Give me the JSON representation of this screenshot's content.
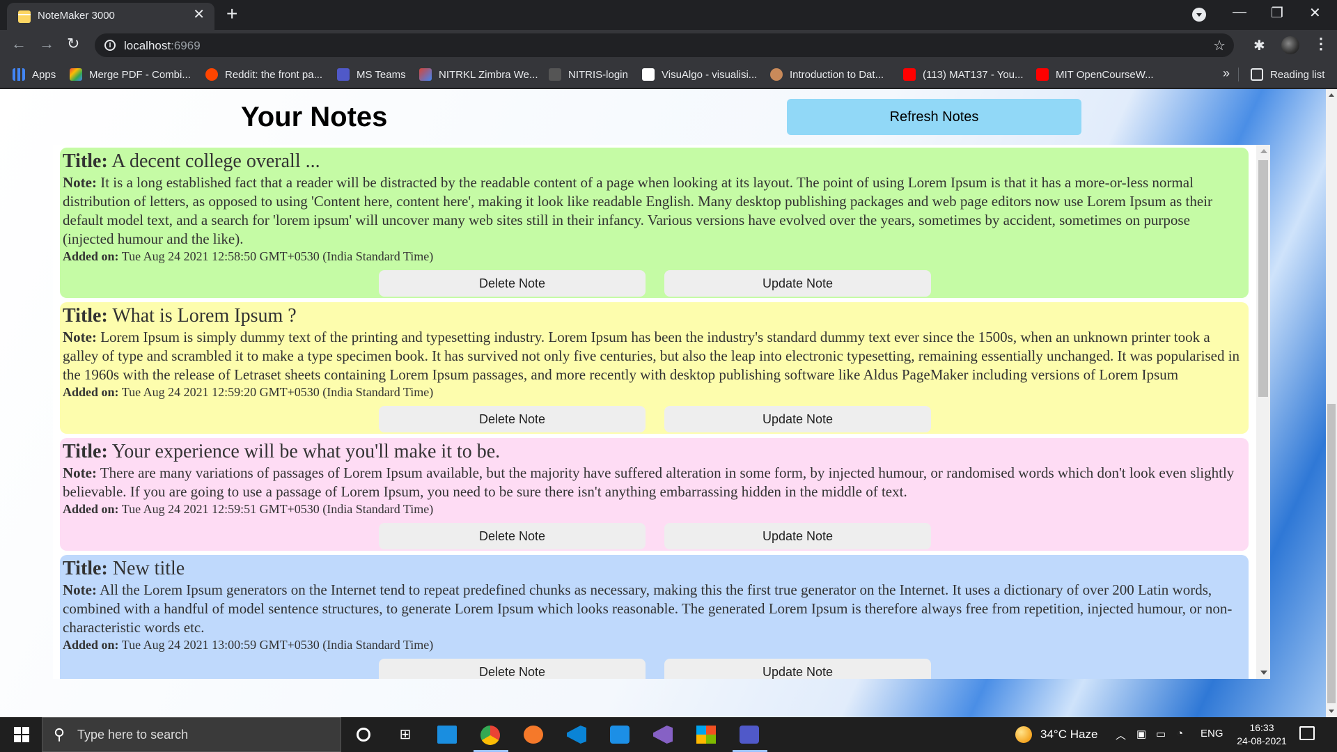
{
  "browser": {
    "tab_title": "NoteMaker 3000",
    "new_tab": "+",
    "url_host": "localhost",
    "url_port": ":6969",
    "window_controls": [
      "—",
      "❐",
      "✕"
    ]
  },
  "bookmarks": [
    {
      "label": "Apps",
      "color": "#4285f4"
    },
    {
      "label": "Merge PDF - Combi...",
      "color": "#e94335"
    },
    {
      "label": "Reddit: the front pa...",
      "color": "#ff4500"
    },
    {
      "label": "MS Teams",
      "color": "#5059c9"
    },
    {
      "label": "NITRKL Zimbra We...",
      "color": "#d44638"
    },
    {
      "label": "NITRIS-login",
      "color": "#777777"
    },
    {
      "label": "VisuAlgo - visualisi...",
      "color": "#ffffff"
    },
    {
      "label": "Introduction to Dat...",
      "color": "#c98a5a"
    },
    {
      "label": "(113) MAT137 - You...",
      "color": "#ff0000"
    },
    {
      "label": "MIT OpenCourseW...",
      "color": "#ff0000"
    }
  ],
  "bookmarks_more": "»",
  "reading_list": "Reading list",
  "page": {
    "title": "Your Notes",
    "refresh_label": "Refresh Notes",
    "title_prefix": "Title:",
    "note_prefix": "Note:",
    "added_prefix": "Added on:",
    "delete_label": "Delete Note",
    "update_label": "Update Note"
  },
  "notes": [
    {
      "color": "#c5fba5",
      "title": "A decent college overall ...",
      "body": "It is a long established fact that a reader will be distracted by the readable content of a page when looking at its layout. The point of using Lorem Ipsum is that it has a more-or-less normal distribution of letters, as opposed to using 'Content here, content here', making it look like readable English. Many desktop publishing packages and web page editors now use Lorem Ipsum as their default model text, and a search for 'lorem ipsum' will uncover many web sites still in their infancy. Various versions have evolved over the years, sometimes by accident, sometimes on purpose (injected humour and the like).",
      "date": "Tue Aug 24 2021 12:58:50 GMT+0530 (India Standard Time)"
    },
    {
      "color": "#fdfdad",
      "title": "What is Lorem Ipsum ?",
      "body": "Lorem Ipsum is simply dummy text of the printing and typesetting industry. Lorem Ipsum has been the industry's standard dummy text ever since the 1500s, when an unknown printer took a galley of type and scrambled it to make a type specimen book. It has survived not only five centuries, but also the leap into electronic typesetting, remaining essentially unchanged. It was popularised in the 1960s with the release of Letraset sheets containing Lorem Ipsum passages, and more recently with desktop publishing software like Aldus PageMaker including versions of Lorem Ipsum",
      "date": "Tue Aug 24 2021 12:59:20 GMT+0530 (India Standard Time)"
    },
    {
      "color": "#fedcf4",
      "title": "Your experience will be what you'll make it to be.",
      "body": "There are many variations of passages of Lorem Ipsum available, but the majority have suffered alteration in some form, by injected humour, or randomised words which don't look even slightly believable. If you are going to use a passage of Lorem Ipsum, you need to be sure there isn't anything embarrassing hidden in the middle of text.",
      "date": "Tue Aug 24 2021 12:59:51 GMT+0530 (India Standard Time)"
    },
    {
      "color": "#bfd9fc",
      "title": "New title",
      "body": "All the Lorem Ipsum generators on the Internet tend to repeat predefined chunks as necessary, making this the first true generator on the Internet. It uses a dictionary of over 200 Latin words, combined with a handful of model sentence structures, to generate Lorem Ipsum which looks reasonable. The generated Lorem Ipsum is therefore always free from repetition, injected humour, or non-characteristic words etc.",
      "date": "Tue Aug 24 2021 13:00:59 GMT+0530 (India Standard Time)"
    }
  ],
  "taskbar": {
    "search_placeholder": "Type here to search",
    "weather": "34°C  Haze",
    "language": "ENG",
    "time": "16:33",
    "date": "24-08-2021",
    "icons": [
      "cortana-icon",
      "task-view-icon",
      "mail-icon",
      "chrome-icon",
      "blender-icon",
      "vscode-icon",
      "buildbox-icon",
      "visual-studio-icon",
      "microsoft-store-icon",
      "teams-icon"
    ]
  }
}
